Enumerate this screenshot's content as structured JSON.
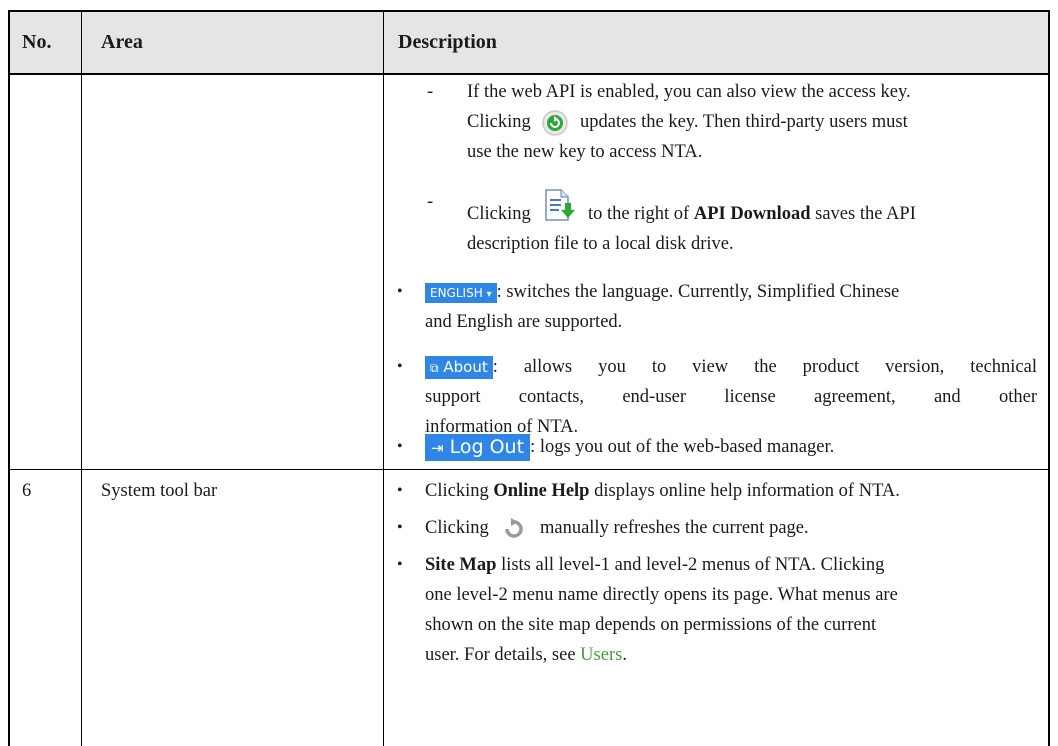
{
  "header": {
    "col_no": "No.",
    "col_area": "Area",
    "col_desc": "Description"
  },
  "row_continued": {
    "dash1_line1": "If the web API is enabled, you can also view the access key.",
    "dash1_line2_a": "Clicking",
    "dash1_line2_b": "updates the key. Then third-party users must",
    "dash1_line3": "use the new key to access NTA.",
    "dash2_line1_a": "Clicking",
    "dash2_line1_b": "to the right of",
    "dash2_line1_bold": "API Download",
    "dash2_line1_c": "saves the API",
    "dash2_line2": "description file to a local disk drive.",
    "lang_button": "ENGLISH",
    "lang_text": ": switches the language. Currently, Simplified Chinese",
    "lang_text2": "and English are supported.",
    "about_button": "About",
    "about_text": ": allows you to view the product version, technical",
    "about_text2": "support contacts, end-user license agreement, and other",
    "about_text3": "information of NTA.",
    "logout_button": "Log Out",
    "logout_text": ": logs you out of the web-based manager."
  },
  "row6": {
    "no": "6",
    "area": "System tool bar",
    "b1_a": "Clicking",
    "b1_bold": "Online Help",
    "b1_b": "displays online help information of NTA.",
    "b2_a": "Clicking",
    "b2_b": "manually refreshes the current page.",
    "b3_bold": "Site Map",
    "b3_l1": "lists all level-1 and level-2 menus of NTA. Clicking",
    "b3_l2": "one level-2 menu name directly opens its page. What menus are",
    "b3_l3": "shown on the site map depends on permissions of the current",
    "b3_l4_a": "user. For details, see",
    "b3_link": "Users",
    "b3_l4_b": "."
  },
  "icons": {
    "refresh_key": "green-refresh-icon",
    "download": "document-download-icon",
    "page_refresh": "gray-refresh-icon",
    "about": "external-window-icon",
    "logout": "logout-icon"
  },
  "colors": {
    "header_bg": "#e5e5e5",
    "button_blue": "#2f86e6",
    "link_green": "#4a9a3a"
  }
}
